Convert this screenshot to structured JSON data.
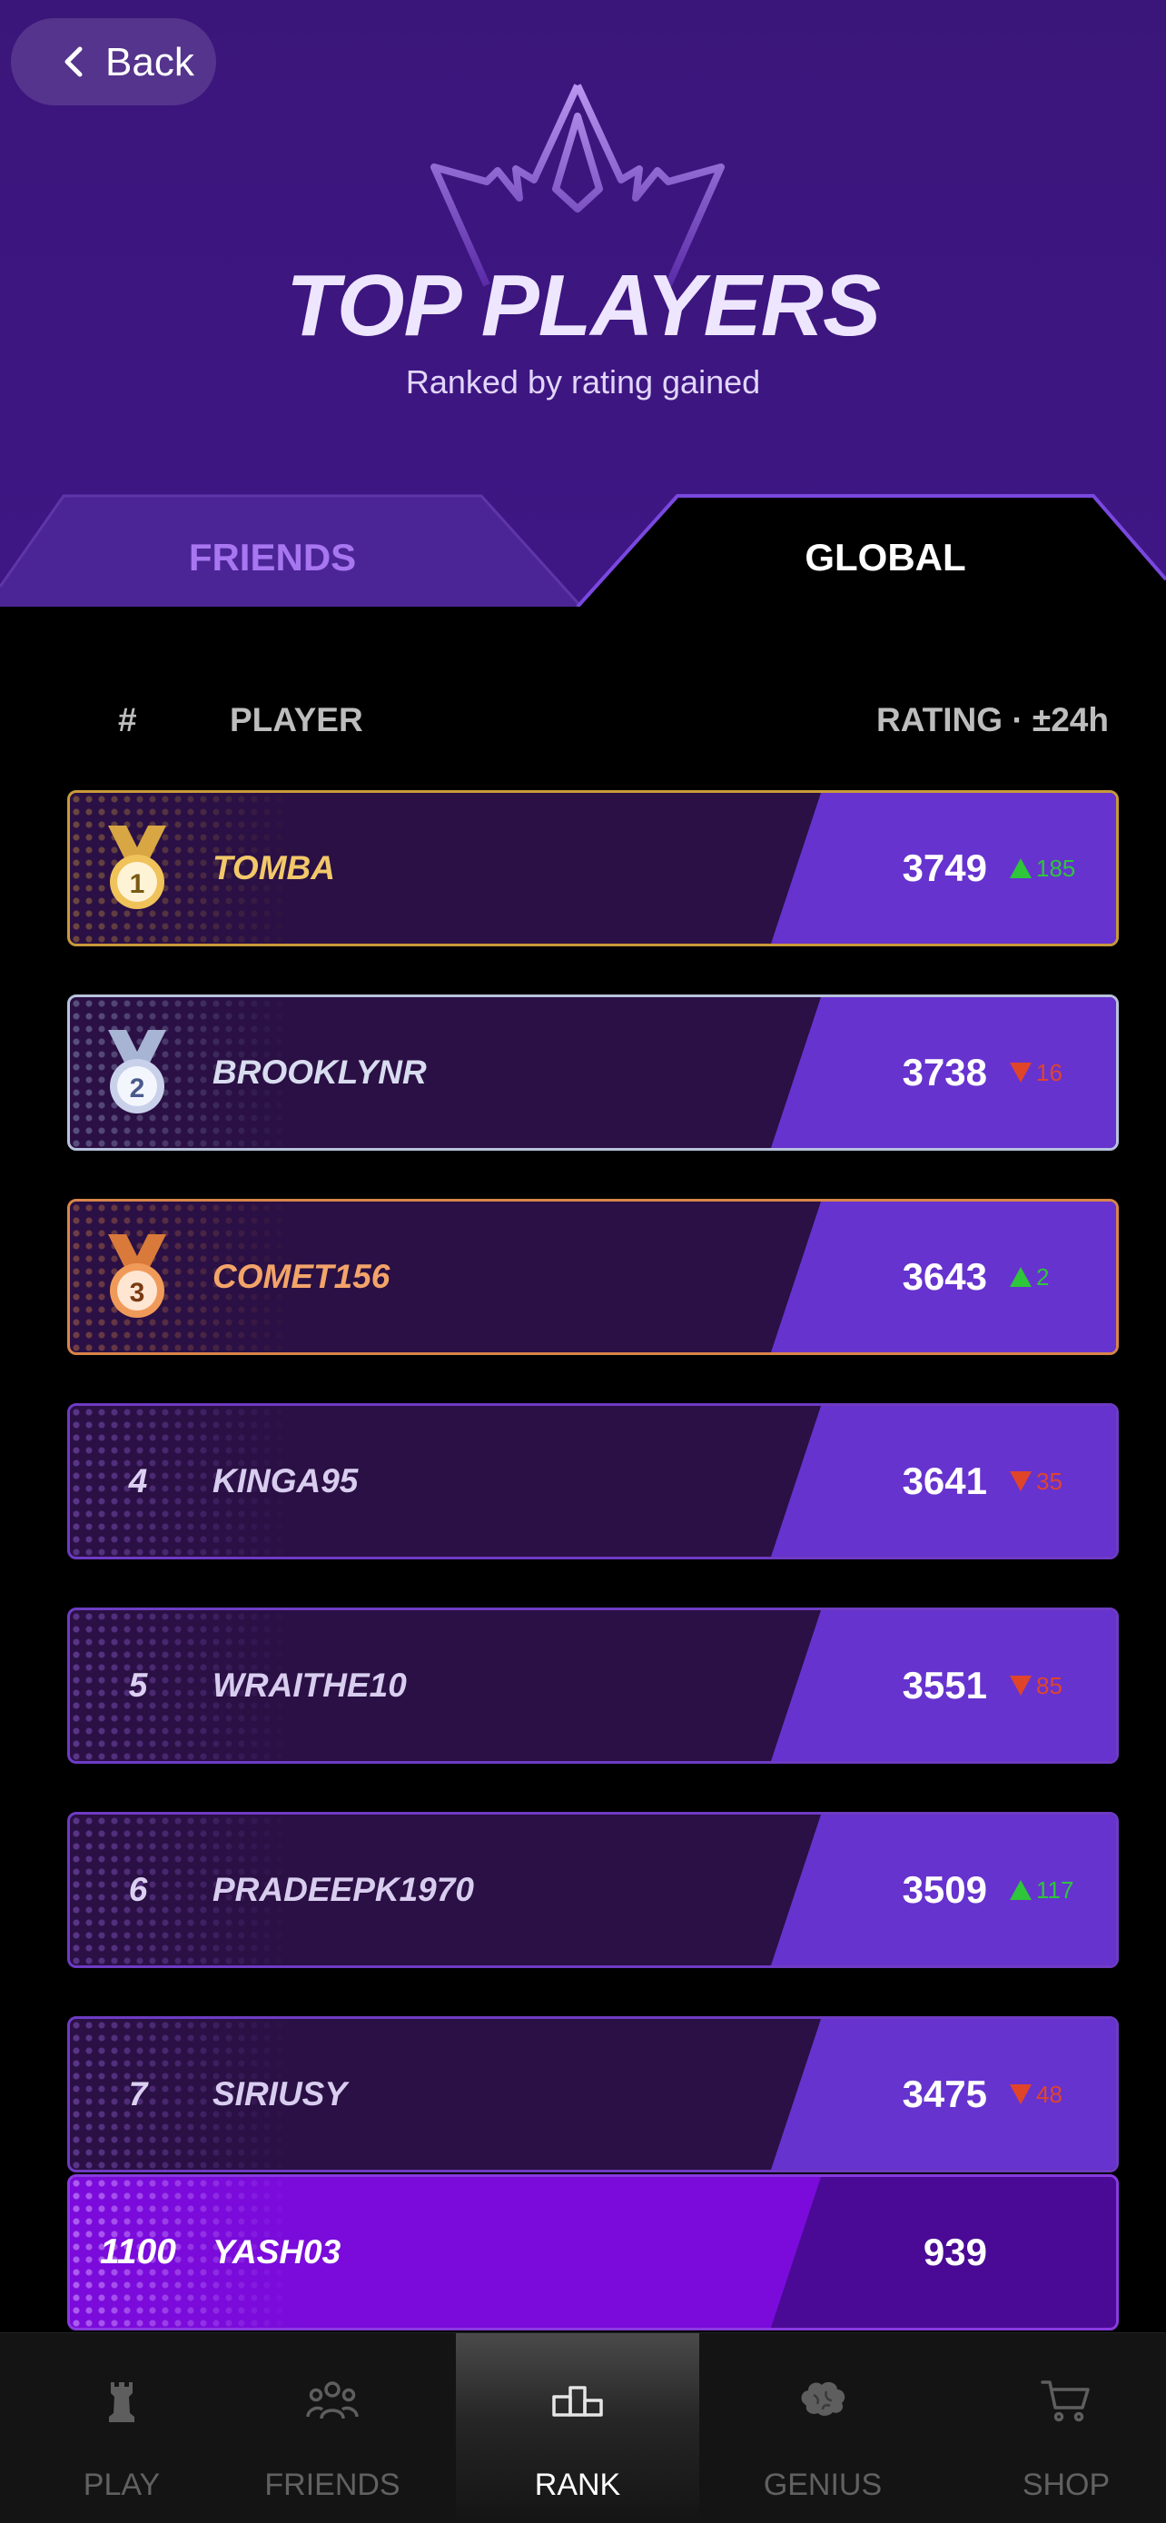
{
  "header": {
    "back_label": "Back",
    "title": "TOP PLAYERS",
    "subtitle": "Ranked by rating gained"
  },
  "tabs": [
    {
      "label": "FRIENDS",
      "active": false
    },
    {
      "label": "GLOBAL",
      "active": true
    }
  ],
  "columns": {
    "rank": "#",
    "player": "PLAYER",
    "rating": "RATING · ±24h"
  },
  "colors": {
    "header_bg": "#3d1680",
    "row_bg": "#2a1044",
    "rating_panel": "#6633cf",
    "gold": "#f2c86a",
    "silver": "#d8dcef",
    "bronze": "#f3a469",
    "up": "#2ec63a",
    "down": "#e0452a",
    "current_user_row": "#7a0bdb"
  },
  "leaderboard": [
    {
      "rank": "1",
      "medal": "gold-medal-icon",
      "name": "TOMBA",
      "rating": "3749",
      "change": "185",
      "direction": "up"
    },
    {
      "rank": "2",
      "medal": "silver-medal-icon",
      "name": "BROOKLYNR",
      "rating": "3738",
      "change": "16",
      "direction": "down"
    },
    {
      "rank": "3",
      "medal": "bronze-medal-icon",
      "name": "COMET156",
      "rating": "3643",
      "change": "2",
      "direction": "up"
    },
    {
      "rank": "4",
      "name": "KINGA95",
      "rating": "3641",
      "change": "35",
      "direction": "down"
    },
    {
      "rank": "5",
      "name": "WRAITHE10",
      "rating": "3551",
      "change": "85",
      "direction": "down"
    },
    {
      "rank": "6",
      "name": "PRADEEPK1970",
      "rating": "3509",
      "change": "117",
      "direction": "up"
    },
    {
      "rank": "7",
      "name": "SIRIUSY",
      "rating": "3475",
      "change": "48",
      "direction": "down"
    }
  ],
  "current_user": {
    "rank": "1100",
    "name": "YASH03",
    "rating": "939"
  },
  "nav": [
    {
      "label": "PLAY",
      "icon": "rook-icon",
      "active": false
    },
    {
      "label": "FRIENDS",
      "icon": "people-icon",
      "active": false
    },
    {
      "label": "RANK",
      "icon": "podium-icon",
      "active": true
    },
    {
      "label": "GENIUS",
      "icon": "brain-icon",
      "active": false
    },
    {
      "label": "SHOP",
      "icon": "cart-icon",
      "active": false
    }
  ]
}
